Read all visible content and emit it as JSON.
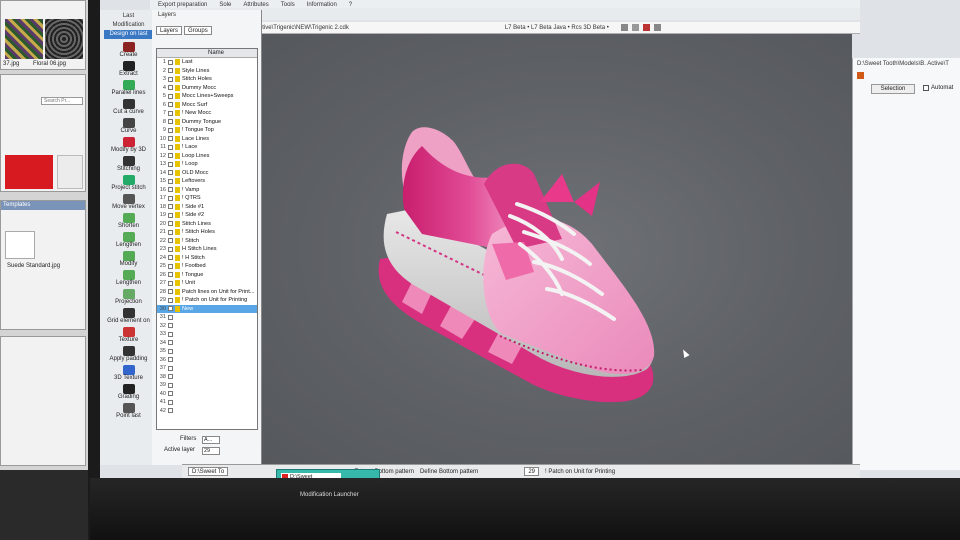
{
  "left_monitor": {
    "file1": "37.jpg",
    "file2": "Floral 06.jpg",
    "search_placeholder": "Search Pr...",
    "file3": "Suede Standard.jpg",
    "window_title": "Templates"
  },
  "menubar": {
    "items": [
      "Export preparation",
      "Sole",
      "Attributes",
      "Tools",
      "Information",
      "?"
    ]
  },
  "docbar": {
    "path": "D:\\Sweet Tooth\\Models\\B. Active\\Trigenic\\NEW\\Trigenic 2.cdk",
    "beta": "L7 Beta • L7 Beta Java • Rcs 3D Beta •"
  },
  "modification": {
    "header": "Last",
    "subheader": "Modification",
    "active_tab": "Design on last",
    "tools": [
      "Create",
      "Extract",
      "Parallel lines",
      "Cut a curve",
      "Curve",
      "Modify by 3D",
      "Stitching",
      "Project stitch",
      "Move vertex",
      "Shorten",
      "Lengthen",
      "Modify",
      "Lengthen",
      "Projection",
      "Grid element on",
      "Texture",
      "Apply padding",
      "3D Texture",
      "Grading",
      "Point last"
    ]
  },
  "layers": {
    "title": "Layers",
    "tabs": [
      "Layers",
      "Groups"
    ],
    "column": "Name",
    "rows": [
      {
        "n": "1",
        "name": "Last"
      },
      {
        "n": "2",
        "name": "Style Lines"
      },
      {
        "n": "3",
        "name": "Stitch Holes"
      },
      {
        "n": "4",
        "name": "Dummy Mocc"
      },
      {
        "n": "5",
        "name": "Mocc Lines+Sweeps"
      },
      {
        "n": "6",
        "name": "Mocc Surf"
      },
      {
        "n": "7",
        "name": "! New Mocc"
      },
      {
        "n": "8",
        "name": "Dummy Tongue"
      },
      {
        "n": "9",
        "name": "! Tongue Top"
      },
      {
        "n": "10",
        "name": "Lace Lines"
      },
      {
        "n": "11",
        "name": "! Lace"
      },
      {
        "n": "12",
        "name": "Loop Lines"
      },
      {
        "n": "13",
        "name": "! Loop"
      },
      {
        "n": "14",
        "name": "OLD Mocc"
      },
      {
        "n": "15",
        "name": "Leftovers"
      },
      {
        "n": "16",
        "name": "! Vamp"
      },
      {
        "n": "17",
        "name": "! QTRS"
      },
      {
        "n": "18",
        "name": "! Side #1"
      },
      {
        "n": "19",
        "name": "! Side #2"
      },
      {
        "n": "20",
        "name": "Stitch Lines"
      },
      {
        "n": "21",
        "name": "! Stitch Holes"
      },
      {
        "n": "22",
        "name": "! Stitch"
      },
      {
        "n": "23",
        "name": "H Stitch Lines"
      },
      {
        "n": "24",
        "name": "! H Stitch"
      },
      {
        "n": "25",
        "name": "! Footbed"
      },
      {
        "n": "26",
        "name": "! Tongue"
      },
      {
        "n": "27",
        "name": "! Unit"
      },
      {
        "n": "28",
        "name": "Patch lines on Unit for Print..."
      },
      {
        "n": "29",
        "name": "! Patch on Unit for Printing"
      },
      {
        "n": "30",
        "name": "New"
      },
      {
        "n": "31",
        "name": ""
      },
      {
        "n": "32",
        "name": ""
      },
      {
        "n": "33",
        "name": ""
      },
      {
        "n": "34",
        "name": ""
      },
      {
        "n": "35",
        "name": ""
      },
      {
        "n": "36",
        "name": ""
      },
      {
        "n": "37",
        "name": ""
      },
      {
        "n": "38",
        "name": ""
      },
      {
        "n": "39",
        "name": ""
      },
      {
        "n": "40",
        "name": ""
      },
      {
        "n": "41",
        "name": ""
      },
      {
        "n": "42",
        "name": ""
      }
    ],
    "filters_label": "Filters",
    "filters_value": "A...",
    "active_layer_label": "Active layer",
    "active_layer_value": "29"
  },
  "rightpanel": {
    "path": "D:\\Sweet Tooth\\Models\\B. Active\\T",
    "selection_label": "Selection",
    "automatic_label": "Automat"
  },
  "statusbar": {
    "doc": "D:\\Sweet To",
    "extract": "Extract Bottom pattern",
    "define": "Define Bottom pattern",
    "layer_no": "29",
    "layer_name": "! Patch on Unit for Printing"
  },
  "popup": {
    "text": "D:\\Sweet"
  },
  "taskbar_text": "Modification   Launcher",
  "colors": {
    "accent": "#3b78c4",
    "selected_row": "#58a6e6",
    "shoe_pink": "#e24a8e",
    "popup": "#36b8ab"
  }
}
